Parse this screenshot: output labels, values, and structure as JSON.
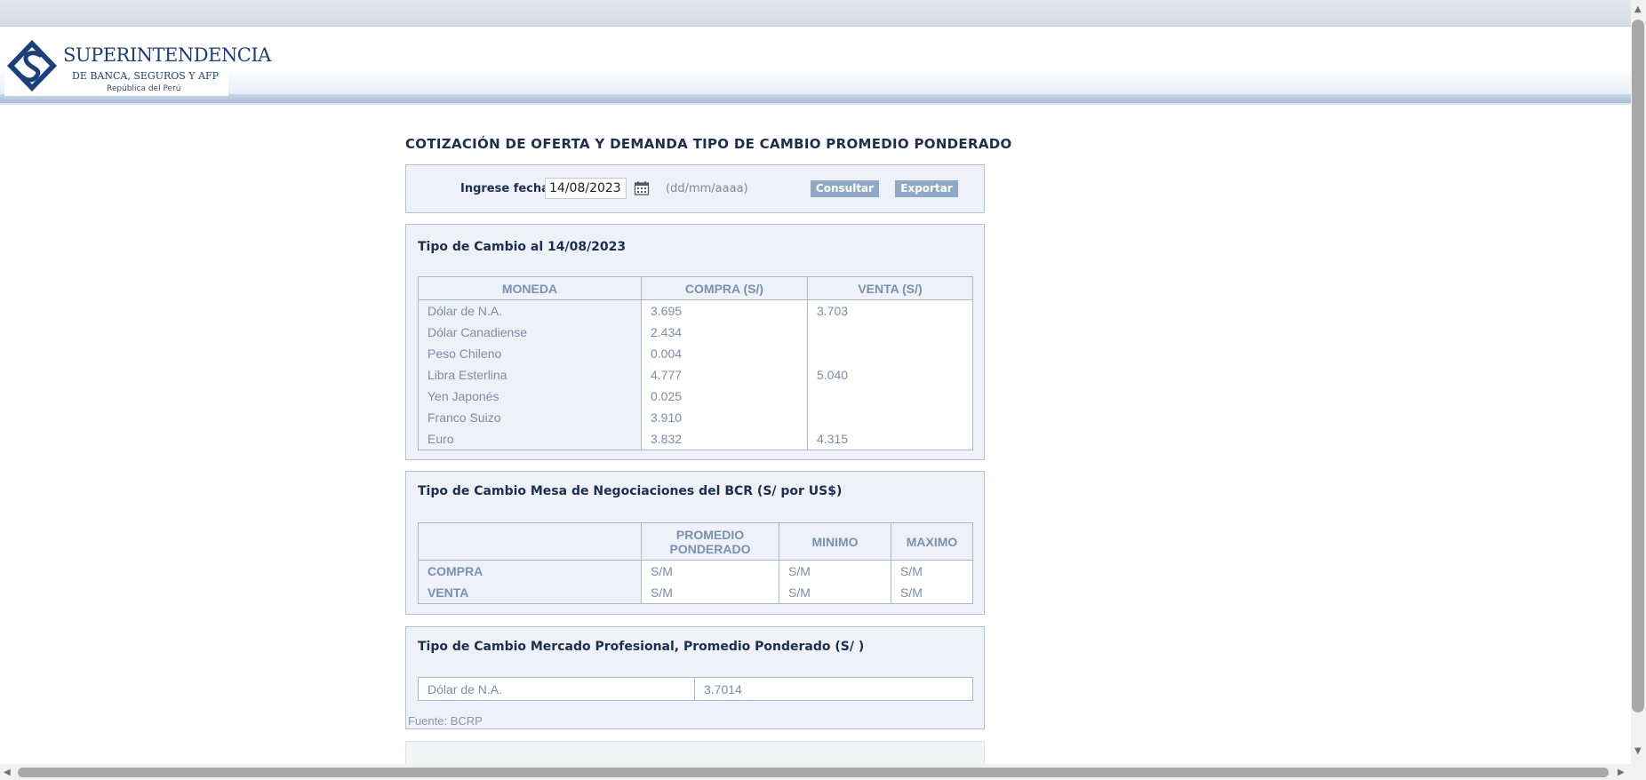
{
  "header": {
    "logo_line1": "SUPERINTENDENCIA",
    "logo_line2": "DE BANCA, SEGUROS Y AFP",
    "logo_line3": "República del Perú"
  },
  "page_title": "COTIZACIÓN DE OFERTA Y DEMANDA TIPO DE CAMBIO PROMEDIO PONDERADO",
  "date_form": {
    "label": "Ingrese fecha:",
    "date_value": "14/08/2023",
    "format_hint": "(dd/mm/aaaa)",
    "consult_label": "Consultar",
    "export_label": "Exportar"
  },
  "exchange_panel": {
    "title": "Tipo de Cambio al 14/08/2023",
    "headers": [
      "MONEDA",
      "COMPRA (S/)",
      "VENTA (S/)"
    ],
    "rows": [
      {
        "moneda": "Dólar de N.A.",
        "compra": "3.695",
        "venta": "3.703"
      },
      {
        "moneda": "Dólar Canadiense",
        "compra": "2.434",
        "venta": ""
      },
      {
        "moneda": "Peso Chileno",
        "compra": "0.004",
        "venta": ""
      },
      {
        "moneda": "Libra Esterlina",
        "compra": "4.777",
        "venta": "5.040"
      },
      {
        "moneda": "Yen Japonés",
        "compra": "0.025",
        "venta": ""
      },
      {
        "moneda": "Franco Suizo",
        "compra": "3.910",
        "venta": ""
      },
      {
        "moneda": "Euro",
        "compra": "3.832",
        "venta": "4.315"
      }
    ]
  },
  "bcr_panel": {
    "title": "Tipo de Cambio Mesa de Negociaciones del BCR (S/ por US$)",
    "headers": [
      "",
      "PROMEDIO PONDERADO",
      "MINIMO",
      "MAXIMO"
    ],
    "rows": [
      {
        "label": "COMPRA",
        "promedio": "S/M",
        "minimo": "S/M",
        "maximo": "S/M"
      },
      {
        "label": "VENTA",
        "promedio": "S/M",
        "minimo": "S/M",
        "maximo": "S/M"
      }
    ]
  },
  "professional_panel": {
    "title": "Tipo de Cambio Mercado Profesional, Promedio Ponderado (S/ )",
    "row": {
      "moneda": "Dólar de N.A.",
      "valor": "3.7014"
    },
    "source": "Fuente: BCRP"
  },
  "icons": {
    "calendar": "calendar-icon",
    "logo": "sbs-logo-icon"
  },
  "colors": {
    "title_text": "#1c2e52",
    "panel_bg": "#eef2f8",
    "header_text": "#7891b3",
    "button_bg": "#8fa8c7",
    "cell_text": "#7d8da5"
  }
}
